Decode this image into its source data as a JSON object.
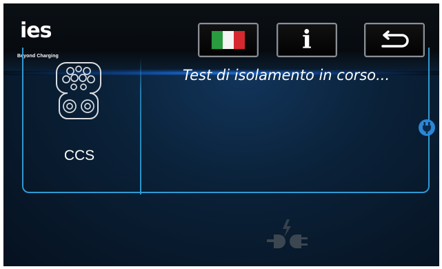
{
  "brand": {
    "logo_mark": "ies",
    "tagline": "Beyond Charging"
  },
  "toolbar": {
    "language_flag": "italian-flag-icon",
    "info_label": "i",
    "back_icon": "return-arrow-icon"
  },
  "connector": {
    "type_label": "CCS",
    "icon": "ccs-connector-icon"
  },
  "status": {
    "message": "Test di isolamento in corso...",
    "indicator_icon": "plug-connected-icon",
    "footer_icon": "plug-unplug-icon"
  },
  "colors": {
    "accent": "#2e9ad2",
    "background": "#05101c",
    "topbar": "#0b1015",
    "indicator": "#2a86d6",
    "flag_green": "#2a9a3f",
    "flag_white": "#f4f4f4",
    "flag_red": "#d7282f"
  }
}
